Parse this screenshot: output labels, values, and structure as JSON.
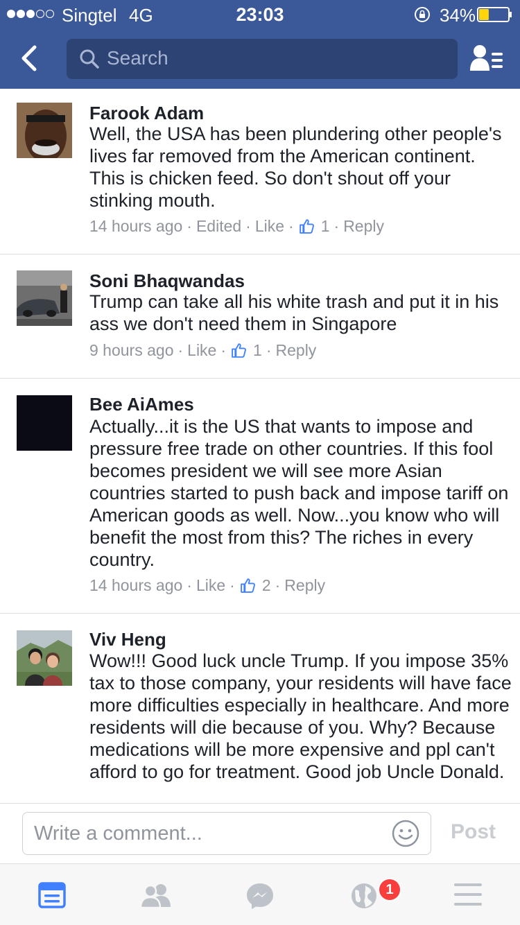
{
  "status_bar": {
    "carrier": "Singtel",
    "network": "4G",
    "time": "23:03",
    "battery_percent": "34%",
    "battery_level": 0.34,
    "signal_bars": 3,
    "signal_total": 5
  },
  "nav": {
    "search_placeholder": "Search"
  },
  "comments": [
    {
      "name": "Farook Adam",
      "text": "Well, the USA has been plundering other people's lives far removed from the American continent. This is chicken feed. So don't shout off your stinking mouth.",
      "time": "14 hours ago",
      "edited": "Edited",
      "like_label": "Like",
      "likes": "1",
      "reply_label": "Reply"
    },
    {
      "name": "Soni Bhaqwandas",
      "text": "Trump can take all his white trash and put it in his ass we don't need them in Singapore",
      "time": "9 hours ago",
      "like_label": "Like",
      "likes": "1",
      "reply_label": "Reply"
    },
    {
      "name": "Bee AiAmes",
      "text": "Actually...it is the US that wants to impose and pressure free trade on other countries. If this fool becomes president we will see more Asian countries started to push back and impose tariff on American goods as well. Now...you know who will benefit the most from this? The riches in every country.",
      "time": "14 hours ago",
      "like_label": "Like",
      "likes": "2",
      "reply_label": "Reply"
    },
    {
      "name": "Viv Heng",
      "text": "Wow!!! Good luck uncle Trump. If you impose 35% tax to those company, your residents will have face more difficulties especially in healthcare. And more residents will die because of you. Why? Because medications will be more expensive and ppl can't afford to go for treatment. Good job Uncle Donald."
    }
  ],
  "composer": {
    "placeholder": "Write a comment...",
    "post_label": "Post"
  },
  "tab_bar": {
    "notifications_badge": "1"
  },
  "colors": {
    "header_blue": "#3b5998",
    "active_tab": "#4080ff",
    "badge_red": "#fa3e3e"
  }
}
